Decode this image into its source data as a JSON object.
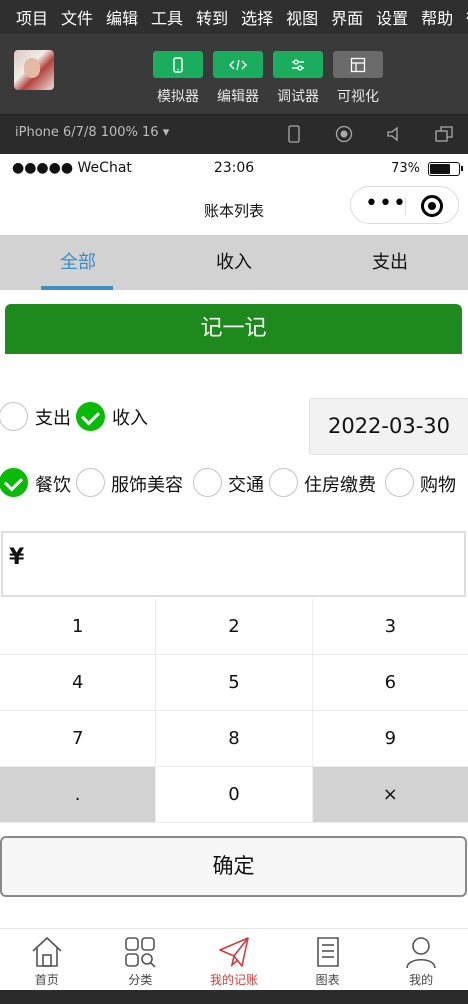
{
  "menu": [
    "项目",
    "文件",
    "编辑",
    "工具",
    "转到",
    "选择",
    "视图",
    "界面",
    "设置",
    "帮助",
    "微"
  ],
  "toolbar": {
    "buttons": [
      {
        "label": "模拟器",
        "icon": "phone-icon"
      },
      {
        "label": "编辑器",
        "icon": "code-icon"
      },
      {
        "label": "调试器",
        "icon": "debug-icon"
      },
      {
        "label": "可视化",
        "icon": "layout-icon"
      }
    ]
  },
  "device": {
    "label": "iPhone 6/7/8 100% 16 ▾"
  },
  "status": {
    "carrier": "●●●●● WeChat",
    "time": "23:06",
    "battery": "73%",
    "battery_level": 0.73
  },
  "nav": {
    "title": "账本列表"
  },
  "tabs": [
    "全部",
    "收入",
    "支出"
  ],
  "record_button": "记一记",
  "type_options": [
    {
      "label": "支出",
      "checked": false
    },
    {
      "label": "收入",
      "checked": true
    }
  ],
  "date": "2022-03-30",
  "categories": [
    {
      "label": "餐饮",
      "checked": true
    },
    {
      "label": "服饰美容",
      "checked": false
    },
    {
      "label": "交通",
      "checked": false
    },
    {
      "label": "住房缴费",
      "checked": false
    },
    {
      "label": "购物",
      "checked": false
    }
  ],
  "amount": {
    "symbol": "¥",
    "value": ""
  },
  "keypad": [
    [
      "1",
      "2",
      "3"
    ],
    [
      "4",
      "5",
      "6"
    ],
    [
      "7",
      "8",
      "9"
    ],
    [
      ".",
      "0",
      "×"
    ]
  ],
  "confirm": "确定",
  "tabbar": [
    {
      "label": "首页",
      "icon": "home-icon"
    },
    {
      "label": "分类",
      "icon": "category-icon"
    },
    {
      "label": "我的记账",
      "icon": "paper-plane-icon",
      "active": true
    },
    {
      "label": "图表",
      "icon": "document-icon"
    },
    {
      "label": "我的",
      "icon": "user-icon"
    }
  ],
  "colors": {
    "accent_green": "#1aad5e",
    "record_green": "#1e8a1e",
    "check_green": "#09bb07",
    "tab_blue": "#3b8fc4",
    "active_red": "#d43a3a"
  }
}
